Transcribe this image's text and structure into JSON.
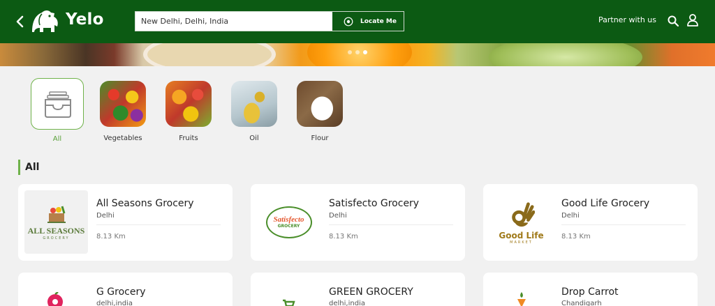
{
  "header": {
    "brand": "Yelo",
    "search_value": "New Delhi, Delhi, India",
    "locate_label": "Locate Me",
    "partner_label": "Partner with us",
    "bg_color": "#0c5a13"
  },
  "banner": {
    "slides": 3,
    "active_slide": 3
  },
  "categories": [
    {
      "label": "All",
      "selected": true
    },
    {
      "label": "Vegetables"
    },
    {
      "label": "Fruits"
    },
    {
      "label": "Oil"
    },
    {
      "label": "Flour"
    }
  ],
  "section": {
    "title": "All",
    "accent": "#6fb24a"
  },
  "stores": [
    {
      "name": "All Seasons Grocery",
      "city": "Delhi",
      "distance": "8.13 Km",
      "logo_text": "ALL SEASONS",
      "logo_sub": "GROCERY"
    },
    {
      "name": "Satisfecto Grocery",
      "city": "Delhi",
      "distance": "8.13 Km",
      "logo_text": "Satisfecto",
      "logo_sub": "GROCERY"
    },
    {
      "name": "Good Life Grocery",
      "city": "Delhi",
      "distance": "8.13 Km",
      "logo_text": "Good Life",
      "logo_sub": "MARKET"
    },
    {
      "name": "G Grocery",
      "city": "delhi,india"
    },
    {
      "name": "GREEN GROCERY",
      "city": "delhi,india"
    },
    {
      "name": "Drop Carrot",
      "city": "Chandigarh"
    }
  ]
}
